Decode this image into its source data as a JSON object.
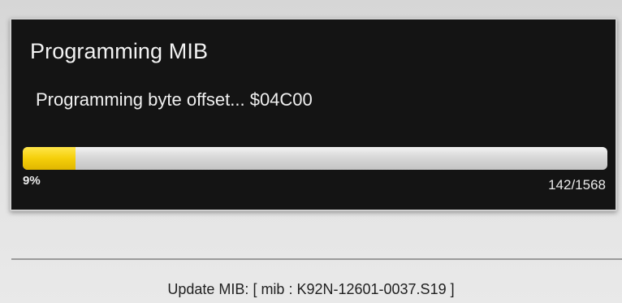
{
  "dialog": {
    "title": "Programming MIB",
    "status": "Programming byte offset... $04C00",
    "progress": {
      "fraction": 0.09,
      "percent_label": "9%",
      "count_label": "142/1568"
    }
  },
  "footer": {
    "text": "Update MIB: [ mib : K92N-12601-0037.S19 ]"
  },
  "colors": {
    "dialog_bg": "#141414",
    "progress_fill": "#f5cf0a",
    "progress_track": "#d8d8d8"
  }
}
